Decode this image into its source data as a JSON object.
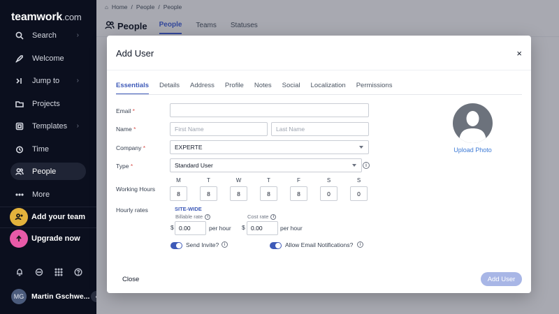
{
  "sidebar": {
    "logo_main": "teamwork",
    "logo_suffix": ".com",
    "items": [
      {
        "label": "Search",
        "icon": "search-icon",
        "chevron": "›"
      },
      {
        "label": "Welcome",
        "icon": "rocket-icon"
      },
      {
        "label": "Jump to",
        "icon": "jump-icon",
        "chevron": "›"
      },
      {
        "label": "Projects",
        "icon": "folder-icon"
      },
      {
        "label": "Templates",
        "icon": "templates-icon",
        "chevron": "›"
      },
      {
        "label": "Time",
        "icon": "clock-icon"
      },
      {
        "label": "People",
        "icon": "people-icon"
      },
      {
        "label": "More",
        "icon": "more-dots-icon"
      }
    ],
    "promo_team": "Add your team",
    "promo_upgrade": "Upgrade now",
    "user_initials": "MG",
    "user_name": "Martin Gschwe...",
    "collapse_glyph": "‹",
    "colors": {
      "bg": "#0b0f1e",
      "team_circle": "#e3b23c",
      "upgrade_circle": "#e85aa8"
    }
  },
  "breadcrumb": [
    "Home",
    "People",
    "People"
  ],
  "breadcrumb_sep": "/",
  "page": {
    "title": "People",
    "tabs": [
      "People",
      "Teams",
      "Statuses"
    ]
  },
  "modal": {
    "title": "Add User",
    "close_glyph": "×",
    "tabs": [
      "Essentials",
      "Details",
      "Address",
      "Profile",
      "Notes",
      "Social",
      "Localization",
      "Permissions"
    ],
    "required_mark": "*",
    "fields": {
      "email_label": "Email",
      "name_label": "Name",
      "first_name_placeholder": "First Name",
      "last_name_placeholder": "Last Name",
      "company_label": "Company",
      "company_value": "EXPERTE",
      "type_label": "Type",
      "type_value": "Standard User",
      "working_hours_label": "Working Hours",
      "days": [
        "M",
        "T",
        "W",
        "T",
        "F",
        "S",
        "S"
      ],
      "hours": [
        "8",
        "8",
        "8",
        "8",
        "8",
        "0",
        "0"
      ],
      "hourly_rates_label": "Hourly rates",
      "site_wide": "SITE-WIDE",
      "billable_rate_label": "Billable rate",
      "cost_rate_label": "Cost rate",
      "currency": "$",
      "billable_value": "0.00",
      "cost_value": "0.00",
      "per_hour": "per hour",
      "send_invite_label": "Send Invite?",
      "email_notifications_label": "Allow Email Notifications?"
    },
    "info_glyph": "i",
    "upload_photo": "Upload Photo",
    "close_button": "Close",
    "add_button": "Add User",
    "colors": {
      "accent": "#3e5ab8",
      "add_button": "#a8b6e6",
      "link": "#3e7bd6",
      "required": "#d9534f"
    }
  }
}
